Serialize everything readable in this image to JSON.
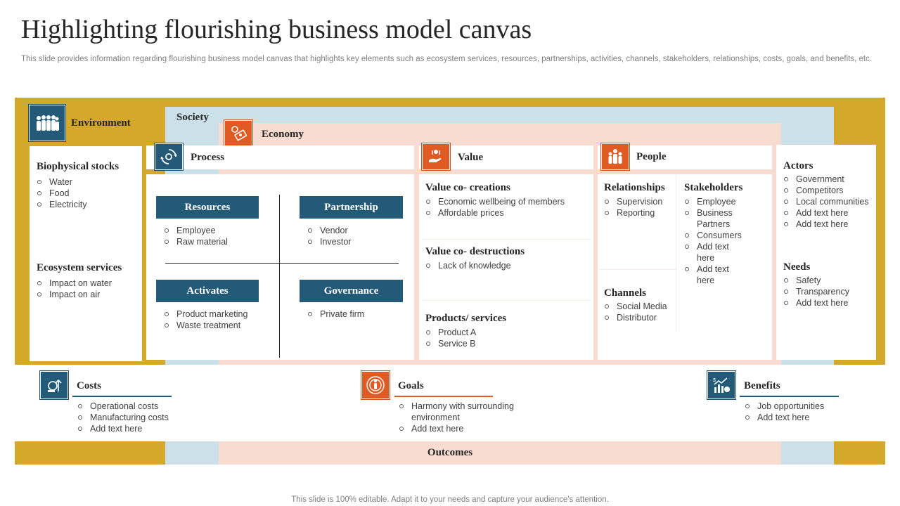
{
  "title": "Highlighting flourishing business model canvas",
  "subtitle": "This slide provides information regarding flourishing business model canvas that highlights key elements such as ecosystem services, resources, partnerships, activities, channels, stakeholders, relationships, costs, goals, and benefits, etc.",
  "layers": {
    "environment": "Environment",
    "society": "Society",
    "economy": "Economy",
    "outcomes": "Outcomes"
  },
  "environment": {
    "biophysical": {
      "heading": "Biophysical stocks",
      "items": [
        "Water",
        "Food",
        "Electricity"
      ]
    },
    "ecosystem": {
      "heading": "Ecosystem services",
      "items": [
        "Impact on water",
        "Impact on air"
      ]
    }
  },
  "process": {
    "label": "Process",
    "resources": {
      "label": "Resources",
      "items": [
        "Employee",
        "Raw material"
      ]
    },
    "partnership": {
      "label": "Partnership",
      "items": [
        "Vendor",
        "Investor"
      ]
    },
    "activates": {
      "label": "Activates",
      "items": [
        "Product marketing",
        "Waste treatment"
      ]
    },
    "governance": {
      "label": "Governance",
      "items": [
        "Private firm"
      ]
    }
  },
  "value": {
    "label": "Value",
    "creations": {
      "heading": "Value co- creations",
      "items": [
        "Economic wellbeing of members",
        "Affordable  prices"
      ]
    },
    "destructions": {
      "heading": "Value co- destructions",
      "items": [
        "Lack of knowledge"
      ]
    },
    "products": {
      "heading": "Products/ services",
      "items": [
        "Product A",
        "Service B"
      ]
    }
  },
  "people": {
    "label": "People",
    "relationships": {
      "heading": "Relationships",
      "items": [
        "Supervision",
        "Reporting"
      ]
    },
    "stakeholders": {
      "heading": "Stakeholders",
      "items": [
        "Employee",
        "Business Partners",
        "Consumers",
        "Add text here",
        "Add text here"
      ]
    },
    "channels": {
      "heading": "Channels",
      "items": [
        "Social Media",
        "Distributor"
      ]
    }
  },
  "society_right": {
    "actors": {
      "heading": "Actors",
      "items": [
        "Government",
        "Competitors",
        "Local communities",
        "Add text here",
        "Add text here"
      ]
    },
    "needs": {
      "heading": "Needs",
      "items": [
        "Safety",
        "Transparency",
        "Add text here"
      ]
    }
  },
  "costs": {
    "heading": "Costs",
    "items": [
      "Operational costs",
      "Manufacturing  costs",
      "Add text here"
    ]
  },
  "goals": {
    "heading": "Goals",
    "items": [
      "Harmony with surrounding environment",
      "Add text here"
    ]
  },
  "benefits": {
    "heading": "Benefits",
    "items": [
      "Job opportunities",
      "Add text here"
    ]
  },
  "footer": "This slide is 100% editable. Adapt it to your needs and capture your audience's attention.",
  "colors": {
    "gold": "#d4a82a",
    "light_blue": "#cce0ea",
    "pink": "#f8dcd2",
    "navy": "#235a78",
    "orange": "#e05a23"
  },
  "icons": {
    "environment": "people-group-icon",
    "economy": "money-icon",
    "process": "gear-cycle-icon",
    "value": "hand-value-icon",
    "people": "team-icon",
    "costs": "cost-growth-icon",
    "goals": "target-person-icon",
    "benefits": "benefit-chart-icon"
  }
}
